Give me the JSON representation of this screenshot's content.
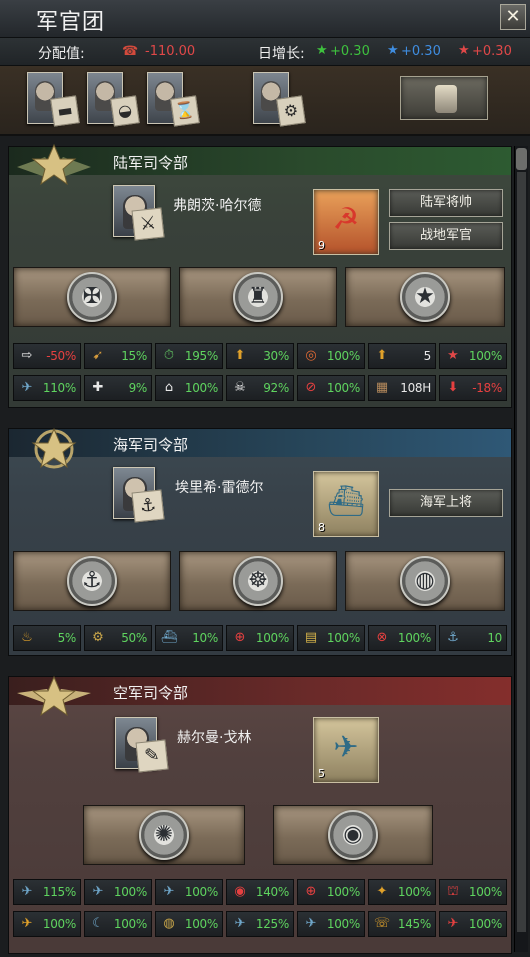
{
  "window": {
    "title": "军官团",
    "close_label": "✕"
  },
  "stats": {
    "allocation_label": "分配值:",
    "allocation_value": "-110.00",
    "daily_label": "日增长:",
    "daily": [
      {
        "value": "+0.30",
        "color": "#3ec13e"
      },
      {
        "value": "+0.30",
        "color": "#3f8de0"
      },
      {
        "value": "+0.30",
        "color": "#e04848"
      }
    ]
  },
  "generals_row": {
    "cards": [
      {
        "note_icon": "tank-icon",
        "glyph": "▬"
      },
      {
        "note_icon": "helmet-icon",
        "glyph": "◒"
      },
      {
        "note_icon": "hourglass-icon",
        "glyph": "⌛"
      },
      {
        "note_icon": "gears-icon",
        "glyph": "⚙"
      }
    ]
  },
  "army": {
    "title": "陆军司令部",
    "commander": "弗朗茨·哈尔德",
    "trait_count": "9",
    "ranks": [
      "陆军将帅",
      "战地军官"
    ],
    "row1": [
      {
        "icon": "⇨",
        "value": "-50%",
        "tone": "neg"
      },
      {
        "icon": "➹",
        "value": "15%",
        "tone": "pos"
      },
      {
        "icon": "⏱",
        "value": "195%",
        "tone": "pos"
      },
      {
        "icon": "⬆",
        "value": "30%",
        "tone": "pos"
      },
      {
        "icon": "◎",
        "value": "100%",
        "tone": "pos"
      },
      {
        "icon": "⬆",
        "value": "5",
        "tone": "neu"
      },
      {
        "icon": "★",
        "value": "100%",
        "tone": "pos"
      }
    ],
    "row2": [
      {
        "icon": "✈",
        "value": "110%",
        "tone": "pos"
      },
      {
        "icon": "✚",
        "value": "9%",
        "tone": "pos"
      },
      {
        "icon": "⌂",
        "value": "100%",
        "tone": "pos"
      },
      {
        "icon": "☠",
        "value": "92%",
        "tone": "pos"
      },
      {
        "icon": "⊘",
        "value": "100%",
        "tone": "pos"
      },
      {
        "icon": "▦",
        "value": "108H",
        "tone": "neu"
      },
      {
        "icon": "⬇",
        "value": "-18%",
        "tone": "pos"
      }
    ]
  },
  "navy": {
    "title": "海军司令部",
    "commander": "埃里希·雷德尔",
    "trait_count": "8",
    "ranks": [
      "海军上将"
    ],
    "row1": [
      {
        "icon": "♨",
        "value": "5%",
        "tone": "pos"
      },
      {
        "icon": "⚙",
        "value": "50%",
        "tone": "pos"
      },
      {
        "icon": "⛴",
        "value": "10%",
        "tone": "pos"
      },
      {
        "icon": "⊕",
        "value": "100%",
        "tone": "pos"
      },
      {
        "icon": "▤",
        "value": "100%",
        "tone": "pos"
      },
      {
        "icon": "⊗",
        "value": "100%",
        "tone": "pos"
      },
      {
        "icon": "⚓",
        "value": "10",
        "tone": "neu"
      }
    ]
  },
  "air": {
    "title": "空军司令部",
    "commander": "赫尔曼·戈林",
    "trait_count": "5",
    "row1": [
      {
        "icon": "✈",
        "value": "115%",
        "tone": "pos"
      },
      {
        "icon": "✈",
        "value": "100%",
        "tone": "pos"
      },
      {
        "icon": "✈",
        "value": "100%",
        "tone": "pos"
      },
      {
        "icon": "◉",
        "value": "140%",
        "tone": "pos"
      },
      {
        "icon": "⊕",
        "value": "100%",
        "tone": "pos"
      },
      {
        "icon": "✦",
        "value": "100%",
        "tone": "pos"
      },
      {
        "icon": "⛫",
        "value": "100%",
        "tone": "pos"
      }
    ],
    "row2": [
      {
        "icon": "✈",
        "value": "100%",
        "tone": "pos"
      },
      {
        "icon": "☾",
        "value": "100%",
        "tone": "pos"
      },
      {
        "icon": "◍",
        "value": "100%",
        "tone": "pos"
      },
      {
        "icon": "✈",
        "value": "125%",
        "tone": "pos"
      },
      {
        "icon": "✈",
        "value": "100%",
        "tone": "pos"
      },
      {
        "icon": "☏",
        "value": "145%",
        "tone": "pos"
      },
      {
        "icon": "✈",
        "value": "100%",
        "tone": "pos"
      }
    ]
  }
}
